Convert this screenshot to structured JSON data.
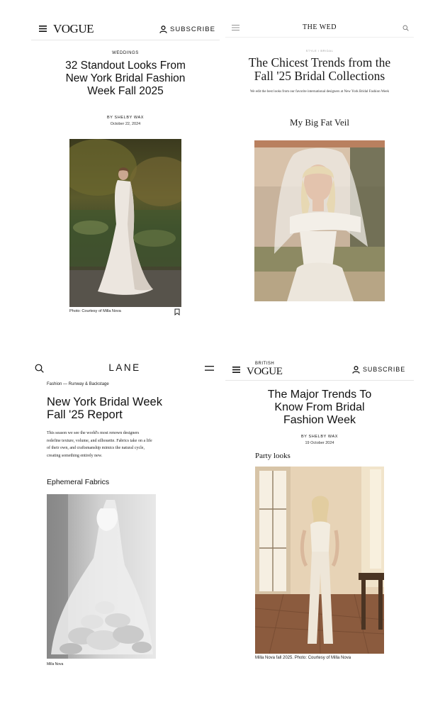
{
  "vogue_us": {
    "logo": "VOGUE",
    "subscribe_label": "SUBSCRIBE",
    "category": "WEDDINGS",
    "headline": "32 Standout Looks From New York Bridal Fashion Week Fall 2025",
    "byline": "BY SHELBY WAX",
    "date": "October 22, 2024",
    "caption": "Photo: Courtesy of Milla Nova"
  },
  "the_wed": {
    "logo": "THE WED",
    "breadcrumb": "STYLE / BRIDAL",
    "headline": "The Chicest Trends from the Fall '25 Bridal Collections",
    "dek": "We edit the best looks from our favorite international designers at New York Bridal Fashion Week",
    "section_heading": "My Big Fat Veil"
  },
  "lane": {
    "logo": "LANE",
    "breadcrumb": "Fashion — Runway & Backstage",
    "headline": "New York Bridal Week Fall '25 Report",
    "body": "This season we see the world's most renown designers redefine texture, volume, and silhouette. Fabrics take on a life of their own, and craftsmanship mimics the natural cycle, creating something entirely new.",
    "section_heading": "Ephemeral Fabrics",
    "caption": "Milla Nova"
  },
  "british_vogue": {
    "logo_small": "BRITISH",
    "logo": "VOGUE",
    "subscribe_label": "SUBSCRIBE",
    "headline": "The Major Trends To Know From Bridal Fashion Week",
    "byline": "BY SHELBY WAX",
    "date": "19 October 2024",
    "section_heading": "Party looks",
    "caption": "Milla Nova fall 2025. Photo: Courtesy of Milla Nova"
  }
}
